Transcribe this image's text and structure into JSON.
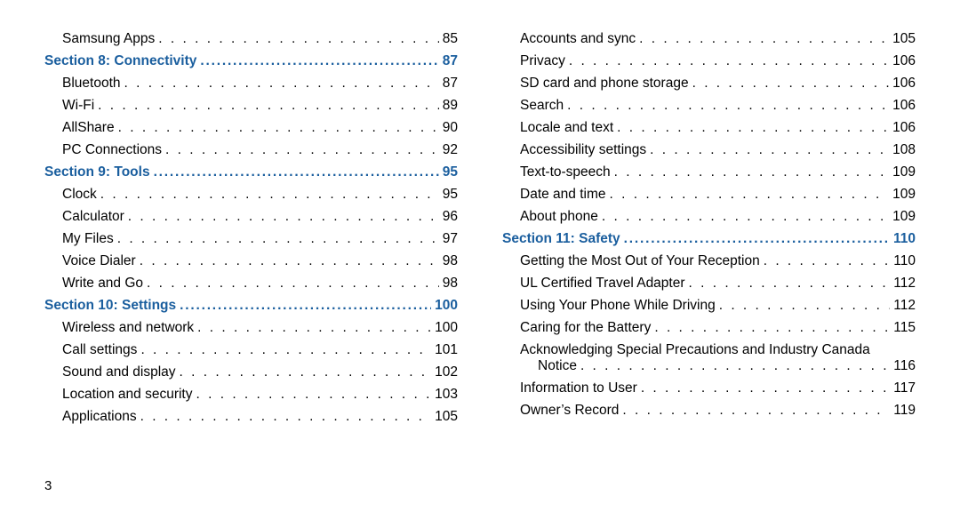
{
  "page_number": "3",
  "columns": [
    {
      "items": [
        {
          "type": "entry",
          "label": "Samsung Apps",
          "page": "85"
        },
        {
          "type": "section",
          "label": "Section 8:  Connectivity",
          "page": "87"
        },
        {
          "type": "entry",
          "label": "Bluetooth",
          "page": "87"
        },
        {
          "type": "entry",
          "label": "Wi-Fi",
          "page": "89"
        },
        {
          "type": "entry",
          "label": "AllShare",
          "page": "90"
        },
        {
          "type": "entry",
          "label": "PC Connections",
          "page": "92"
        },
        {
          "type": "section",
          "label": "Section 9:  Tools",
          "page": "95"
        },
        {
          "type": "entry",
          "label": "Clock",
          "page": "95"
        },
        {
          "type": "entry",
          "label": "Calculator",
          "page": "96"
        },
        {
          "type": "entry",
          "label": "My Files",
          "page": "97"
        },
        {
          "type": "entry",
          "label": "Voice Dialer",
          "page": "98"
        },
        {
          "type": "entry",
          "label": "Write and Go",
          "page": "98"
        },
        {
          "type": "section",
          "label": "Section 10:  Settings",
          "page": "100"
        },
        {
          "type": "entry",
          "label": "Wireless and network",
          "page": "100"
        },
        {
          "type": "entry",
          "label": "Call settings",
          "page": "101"
        },
        {
          "type": "entry",
          "label": "Sound and display",
          "page": "102"
        },
        {
          "type": "entry",
          "label": "Location and security",
          "page": "103"
        },
        {
          "type": "entry",
          "label": "Applications",
          "page": "105"
        }
      ]
    },
    {
      "items": [
        {
          "type": "entry",
          "label": "Accounts and sync",
          "page": "105"
        },
        {
          "type": "entry",
          "label": "Privacy",
          "page": "106"
        },
        {
          "type": "entry",
          "label": "SD card and phone storage",
          "page": "106"
        },
        {
          "type": "entry",
          "label": "Search",
          "page": "106"
        },
        {
          "type": "entry",
          "label": "Locale and text",
          "page": "106"
        },
        {
          "type": "entry",
          "label": "Accessibility settings",
          "page": "108"
        },
        {
          "type": "entry",
          "label": "Text-to-speech",
          "page": "109"
        },
        {
          "type": "entry",
          "label": "Date and time",
          "page": "109"
        },
        {
          "type": "entry",
          "label": "About phone",
          "page": "109"
        },
        {
          "type": "section",
          "label": "Section 11:  Safety",
          "page": "110"
        },
        {
          "type": "entry",
          "label": "Getting the Most Out of Your Reception",
          "page": "110"
        },
        {
          "type": "entry",
          "label": "UL Certified Travel Adapter",
          "page": "112"
        },
        {
          "type": "entry",
          "label": "Using Your Phone While Driving",
          "page": "112"
        },
        {
          "type": "entry",
          "label": "Caring for the Battery",
          "page": "115"
        },
        {
          "type": "entry-wrap",
          "label_first": "Acknowledging Special Precautions and Industry Canada",
          "label_second": "Notice",
          "page": "116"
        },
        {
          "type": "entry",
          "label": "Information to User",
          "page": "117"
        },
        {
          "type": "entry",
          "label": "Owner’s Record",
          "page": "119"
        }
      ]
    }
  ]
}
